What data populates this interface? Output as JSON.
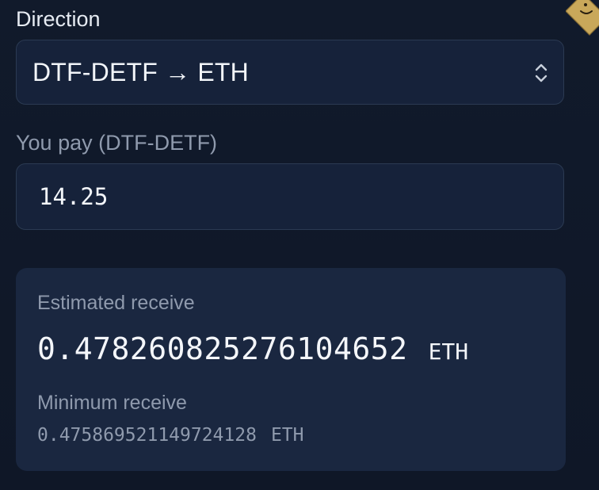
{
  "direction": {
    "label": "Direction",
    "selected": "DTF-DETF → ETH"
  },
  "pay": {
    "label": "You pay (DTF-DETF)",
    "value": "14.25"
  },
  "receive": {
    "estimated_label": "Estimated receive",
    "estimated_value": "0.478260825276104652",
    "estimated_unit": "ETH",
    "minimum_label": "Minimum receive",
    "minimum_value": "0.475869521149724128",
    "minimum_unit": "ETH"
  },
  "icons": {
    "select": "chevron-up-down-icon",
    "corner": "smiley-badge-icon"
  },
  "colors": {
    "background": "#0f1728",
    "field": "#16223a",
    "card": "#1a2740",
    "border": "#2b3a52",
    "muted_text": "#8f9aad",
    "badge": "#c9a85a"
  }
}
